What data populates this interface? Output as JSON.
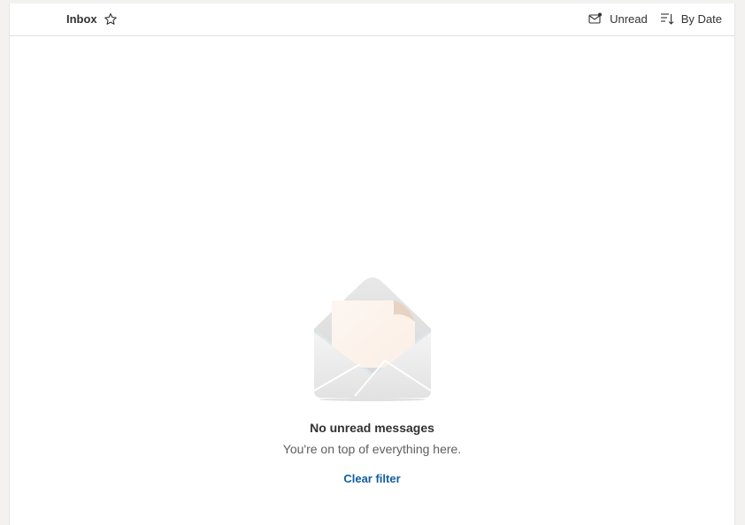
{
  "header": {
    "folder_title": "Inbox",
    "filter_label": "Unread",
    "sort_label": "By Date"
  },
  "empty_state": {
    "title": "No unread messages",
    "subtitle": "You're on top of everything here.",
    "clear_filter_label": "Clear filter"
  },
  "icons": {
    "favorite": "star-outline-icon",
    "filter": "mail-unread-icon",
    "sort": "sort-descending-icon",
    "illustration": "open-envelope-illustration"
  },
  "colors": {
    "accent": "#115ea3",
    "text": "#323130",
    "subtext": "#605e5c"
  }
}
